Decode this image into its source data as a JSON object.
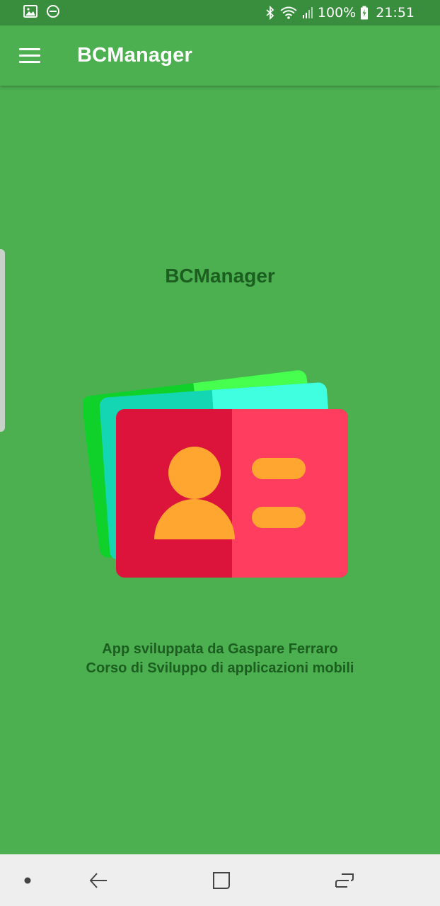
{
  "status_bar": {
    "battery": "100%",
    "time": "21:51",
    "left_icons": [
      "image-icon",
      "do-not-disturb-icon"
    ],
    "right_icons": [
      "bluetooth-icon",
      "wifi-icon",
      "signal-icon",
      "battery-icon"
    ]
  },
  "app_bar": {
    "title": "BCManager",
    "menu_icon": "hamburger-menu-icon"
  },
  "main": {
    "title": "BCManager",
    "illustration": "business-card-icon",
    "credits_line1": "App sviluppata da Gaspare Ferraro",
    "credits_line2": "Corso di Sviluppo di applicazioni mobili"
  },
  "colors": {
    "primary": "#4CAF50",
    "primary_dark": "#388E3C",
    "text_dark_green": "#1B5E20",
    "card_red": "#FF3D5F",
    "card_red_dark": "#DC143C",
    "card_teal": "#3FFFE0",
    "card_green": "#47FF4F",
    "accent_orange": "#FFA630"
  },
  "nav_bar": {
    "items": [
      "recent-dot-icon",
      "back-icon",
      "home-icon",
      "recents-icon"
    ]
  }
}
